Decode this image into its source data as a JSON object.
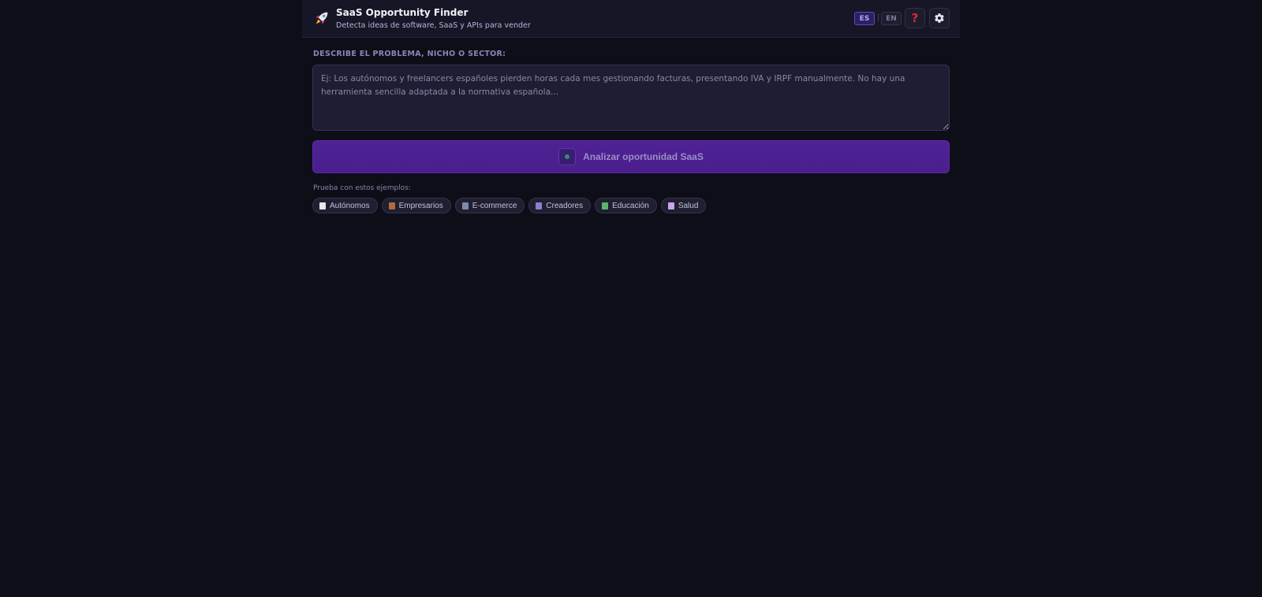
{
  "header": {
    "logo_icon": "rocket-icon",
    "title": "SaaS Opportunity Finder",
    "subtitle": "Detecta ideas de software, SaaS y APIs para vender",
    "lang_es": "ES",
    "lang_separator": "|",
    "lang_en": "EN",
    "help_glyph": "?",
    "help_icon": "question-mark-icon",
    "settings_icon": "gear-icon",
    "active_language": "ES"
  },
  "form": {
    "label": "DESCRIBE EL PROBLEMA, NICHO O SECTOR:",
    "placeholder": "Ej: Los autónomos y freelancers españoles pierden horas cada mes gestionando facturas, presentando IVA y IRPF manualmente. No hay una herramienta sencilla adaptada a la normativa española...",
    "value": "",
    "analyze_label": "Analizar oportunidad SaaS"
  },
  "examples": {
    "label": "Prueba con estos ejemplos:",
    "chips": [
      {
        "label": "Autónomos",
        "icon": "receipt-icon",
        "color": "#e9e6f2"
      },
      {
        "label": "Empresarios",
        "icon": "briefcase-icon",
        "color": "#b5683c"
      },
      {
        "label": "E-commerce",
        "icon": "cart-icon",
        "color": "#7f8aa8"
      },
      {
        "label": "Creadores",
        "icon": "clapperboard-icon",
        "color": "#8b7fc9"
      },
      {
        "label": "Educación",
        "icon": "books-icon",
        "color": "#5bb36a"
      },
      {
        "label": "Salud",
        "icon": "medical-icon",
        "color": "#c9a7e6"
      }
    ]
  },
  "colors": {
    "background": "#0e0e19",
    "header_bg": "#161627",
    "accent": "#4f2295",
    "help_red": "#e4243e"
  }
}
